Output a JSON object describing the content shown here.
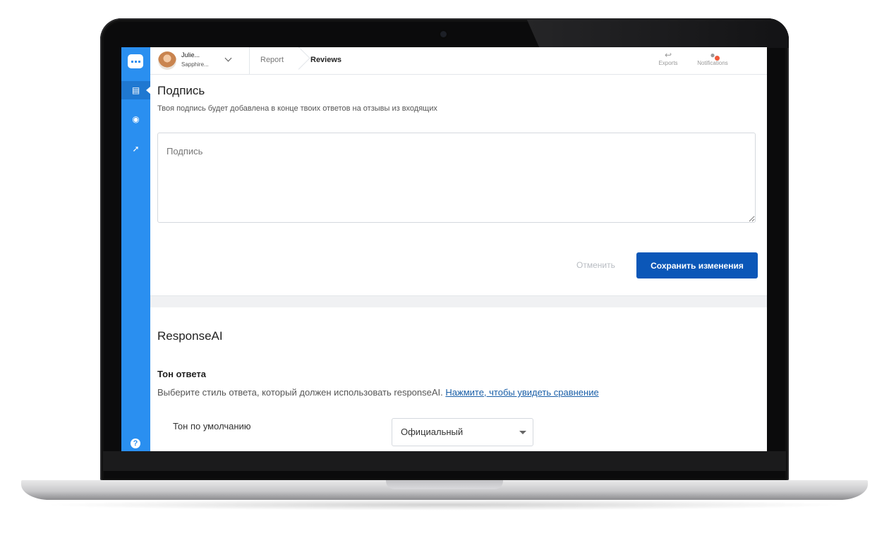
{
  "topbar": {
    "user_name": "Julie...",
    "user_org": "Sapphire...",
    "breadcrumb": [
      "Report",
      "Reviews"
    ],
    "exports_label": "Exports",
    "notifications_label": "Notifications"
  },
  "signature": {
    "title": "Подпись",
    "description": "Твоя подпись будет добавлена в конце твоих ответов на отзывы из входящих",
    "placeholder": "Подпись",
    "cancel_label": "Отменить",
    "save_label": "Сохранить изменения"
  },
  "response_ai": {
    "title": "ResponseAI",
    "tone_title": "Тон ответа",
    "tone_description": "Выберите стиль ответа, который должен использовать responseAI. ",
    "tone_link": "Нажмите, чтобы увидеть сравнение",
    "default_tone_label": "Тон по умолчанию",
    "default_tone_value": "Официальный"
  },
  "sidebar": {
    "items": [
      {
        "icon": "bed-icon",
        "active": true
      },
      {
        "icon": "dining-icon",
        "active": false
      },
      {
        "icon": "rocket-icon",
        "active": false
      }
    ],
    "help_icon": "help-icon"
  },
  "colors": {
    "sidebar": "#2a8ff0",
    "primary_button": "#0b57b8",
    "link": "#1a5fa8"
  }
}
